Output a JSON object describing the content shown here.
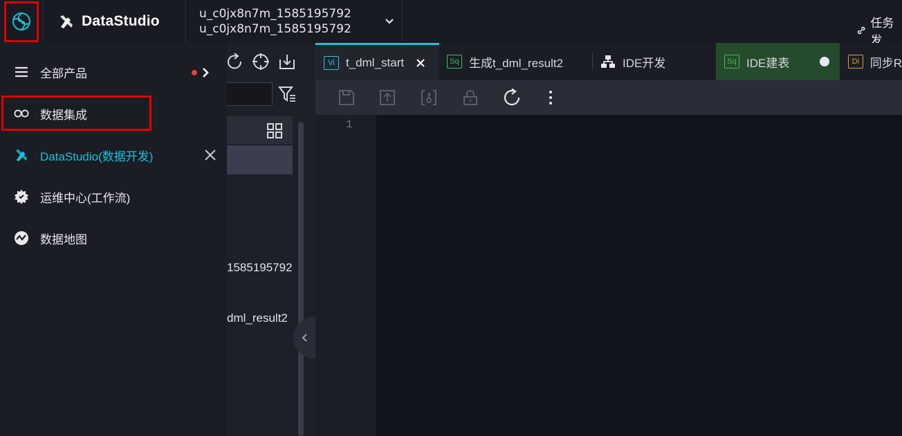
{
  "topbar": {
    "brand": "DataStudio",
    "project_line1": "u_c0jx8n7m_1585195792",
    "project_line2": "u_c0jx8n7m_1585195792",
    "task_link": "任务发"
  },
  "sidemenu": {
    "items": [
      {
        "label": "全部产品",
        "icon": "menu-icon"
      },
      {
        "label": "数据集成",
        "icon": "infinity-icon"
      },
      {
        "label": "DataStudio(数据开发)",
        "icon": "datastudio-icon"
      },
      {
        "label": "运维中心(工作流)",
        "icon": "gear-icon"
      },
      {
        "label": "数据地图",
        "icon": "map-icon"
      }
    ]
  },
  "treepanel": {
    "row1": "1585195792",
    "row2": "dml_result2"
  },
  "tabs": [
    {
      "badge": "Vi",
      "label": "t_dml_start"
    },
    {
      "badge": "Sq",
      "label": "生成t_dml_result2"
    },
    {
      "badge": "",
      "label": "IDE开发"
    },
    {
      "badge": "Sq",
      "label": "IDE建表"
    },
    {
      "badge": "Di",
      "label": "同步R"
    }
  ],
  "editor": {
    "line_numbers": [
      "1"
    ]
  },
  "colors": {
    "accent": "#1ec0d8",
    "highlight": "#e00000",
    "green_tab": "#254a2c"
  }
}
